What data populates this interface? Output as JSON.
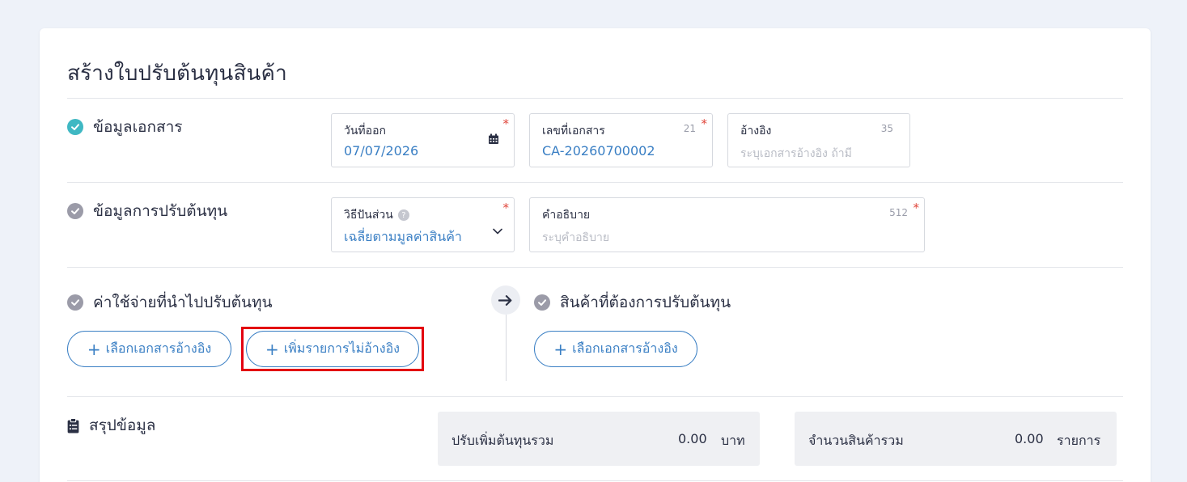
{
  "page": {
    "title": "สร้างใบปรับต้นทุนสินค้า"
  },
  "doc_info": {
    "heading": "ข้อมูลเอกสาร",
    "issue_date": {
      "label": "วันที่ออก",
      "value": "07/07/2026",
      "required": "*"
    },
    "doc_number": {
      "label": "เลขที่เอกสาร",
      "value": "CA-20260700002",
      "counter": "21",
      "required": "*"
    },
    "reference": {
      "label": "อ้างอิง",
      "placeholder": "ระบุเอกสารอ้างอิง ถ้ามี",
      "counter": "35"
    }
  },
  "adjust_info": {
    "heading": "ข้อมูลการปรับต้นทุน",
    "allocation": {
      "label": "วิธีปันส่วน",
      "help": "?",
      "value": "เฉลี่ยตามมูลค่าสินค้า",
      "required": "*"
    },
    "description": {
      "label": "คำอธิบาย",
      "placeholder": "ระบุคำอธิบาย",
      "counter": "512",
      "required": "*"
    }
  },
  "expenses": {
    "heading": "ค่าใช้จ่ายที่นำไปปรับต้นทุน",
    "select_ref_button": "เลือกเอกสารอ้างอิง",
    "add_unref_button": "เพิ่มรายการไม่อ้างอิง"
  },
  "products": {
    "heading": "สินค้าที่ต้องการปรับต้นทุน",
    "select_ref_button": "เลือกเอกสารอ้างอิง"
  },
  "summary": {
    "heading": "สรุปข้อมูล",
    "total_cost": {
      "label": "ปรับเพิ่มต้นทุนรวม",
      "value": "0.00",
      "unit": "บาท"
    },
    "total_items": {
      "label": "จำนวนสินค้ารวม",
      "value": "0.00",
      "unit": "รายการ"
    }
  },
  "colors": {
    "accent": "#3a7fc4",
    "teal": "#3fb8c3",
    "required": "#e0453a",
    "highlight": "#e3000f"
  }
}
